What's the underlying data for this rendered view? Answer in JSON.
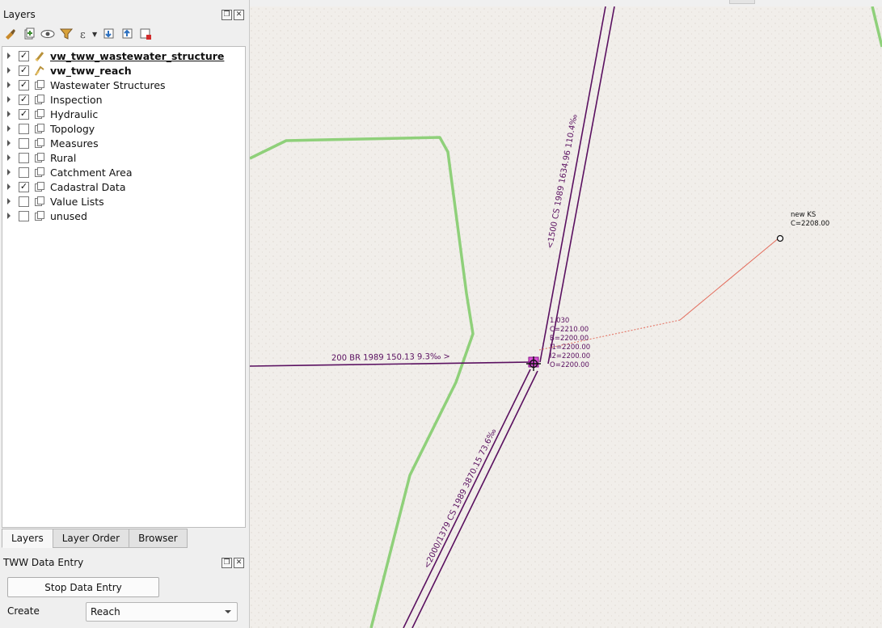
{
  "layers_panel": {
    "title": "Layers",
    "float_icon": "float-icon",
    "close_icon": "close-icon",
    "toolbar": [
      "paint-style-icon",
      "add-group-icon",
      "visibility-icon",
      "filter-icon",
      "expression-filter-icon",
      "expand-all-icon",
      "collapse-all-icon",
      "remove-layer-icon"
    ],
    "layers": [
      {
        "name": "vw_tww_wastewater_structure",
        "checked": true,
        "bold": true,
        "underline": true,
        "icon": "point-layer-icon"
      },
      {
        "name": "vw_tww_reach",
        "checked": true,
        "bold": true,
        "underline": false,
        "icon": "line-layer-icon"
      },
      {
        "name": "Wastewater Structures",
        "checked": true,
        "bold": false,
        "icon": "group-icon"
      },
      {
        "name": "Inspection",
        "checked": true,
        "bold": false,
        "icon": "group-icon"
      },
      {
        "name": "Hydraulic",
        "checked": true,
        "bold": false,
        "icon": "group-icon"
      },
      {
        "name": "Topology",
        "checked": false,
        "bold": false,
        "icon": "group-icon"
      },
      {
        "name": "Measures",
        "checked": false,
        "bold": false,
        "icon": "group-icon"
      },
      {
        "name": "Rural",
        "checked": false,
        "bold": false,
        "icon": "group-icon"
      },
      {
        "name": "Catchment Area",
        "checked": false,
        "bold": false,
        "icon": "group-icon"
      },
      {
        "name": "Cadastral Data",
        "checked": true,
        "bold": false,
        "icon": "group-icon"
      },
      {
        "name": "Value Lists",
        "checked": false,
        "bold": false,
        "icon": "group-icon"
      },
      {
        "name": "unused",
        "checked": false,
        "bold": false,
        "icon": "group-icon"
      }
    ],
    "tabs": [
      "Layers",
      "Layer Order",
      "Browser"
    ],
    "active_tab": "Layers"
  },
  "data_entry": {
    "title": "TWW Data Entry",
    "stop_button": "Stop Data Entry",
    "create_label": "Create",
    "create_value": "Reach"
  },
  "map": {
    "labels": {
      "reach_top": "<1500 CS 1989 1634.96 110.4‰",
      "reach_left": "200 BR 1989 150.13 9.3‰  >",
      "reach_bottom": "<2000/1379 CS 1989 3870.15 73.6‰",
      "node_id": "1.030",
      "node_c": "C=2210.00",
      "node_b": "B=2200.00",
      "node_i1": "I1=2200.00",
      "node_i2": "I2=2200.00",
      "node_o": "O=2200.00",
      "new_name": "new KS",
      "new_c": "C=2208.00"
    },
    "colors": {
      "background": "#f0ede9",
      "reach": "#5a1060",
      "cadastral": "#8fd07a",
      "digitizing": "#e36c5c",
      "snap": "#d020d0"
    }
  }
}
